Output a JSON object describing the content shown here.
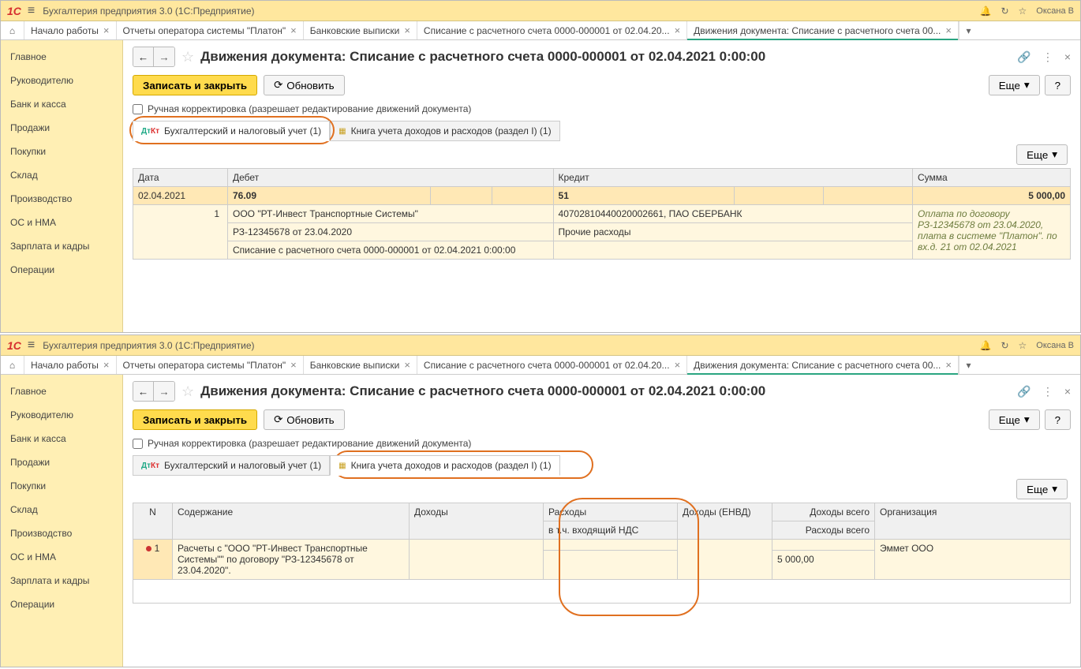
{
  "app_title": "Бухгалтерия предприятия 3.0   (1С:Предприятие)",
  "user": "Оксана В",
  "tabs": [
    {
      "label": "Начало работы"
    },
    {
      "label": "Отчеты оператора системы \"Платон\""
    },
    {
      "label": "Банковские выписки"
    },
    {
      "label": "Списание с расчетного счета 0000-000001 от 02.04.20..."
    },
    {
      "label": "Движения документа: Списание с расчетного счета 00..."
    }
  ],
  "sidebar": [
    "Главное",
    "Руководителю",
    "Банк и касса",
    "Продажи",
    "Покупки",
    "Склад",
    "Производство",
    "ОС и НМА",
    "Зарплата и кадры",
    "Операции"
  ],
  "doc_title": "Движения документа: Списание с расчетного счета 0000-000001 от 02.04.2021 0:00:00",
  "buttons": {
    "save_close": "Записать и закрыть",
    "refresh": "Обновить",
    "more": "Еще",
    "help": "?"
  },
  "checkbox_label": "Ручная корректировка (разрешает редактирование движений документа)",
  "inner_tabs": {
    "accounting": "Бухгалтерский и налоговый учет (1)",
    "kudir": "Книга учета доходов и расходов (раздел I) (1)"
  },
  "acct_headers": {
    "date": "Дата",
    "debit": "Дебет",
    "credit": "Кредит",
    "sum": "Сумма"
  },
  "acct_row1": {
    "date": "02.04.2021",
    "debit": "76.09",
    "credit": "51",
    "sum": "5 000,00"
  },
  "acct_details": {
    "seq": "1",
    "debit1": "ООО \"РТ-Инвест Транспортные Системы\"",
    "debit2": "РЗ-12345678 от 23.04.2020",
    "debit3": "Списание с расчетного счета 0000-000001 от 02.04.2021 0:00:00",
    "credit1": "40702810440020002661, ПАО СБЕРБАНК",
    "credit2": "Прочие расходы",
    "note": "Оплата по договору РЗ-12345678 от 23.04.2020, плата в системе \"Платон\". по вх.д. 21 от 02.04.2021"
  },
  "kudir_headers": {
    "n": "N",
    "content": "Содержание",
    "income": "Доходы",
    "expense": "Расходы",
    "expense_sub": "в т.ч. входящий НДС",
    "envd": "Доходы (ЕНВД)",
    "income_total": "Доходы всего",
    "expense_total": "Расходы всего",
    "org": "Организация"
  },
  "kudir_row": {
    "n": "1",
    "content": "Расчеты с \"ООО \"РТ-Инвест Транспортные Системы\"\" по договору \"РЗ-12345678 от 23.04.2020\".",
    "expense_total": "5 000,00",
    "org": "Эммет ООО"
  }
}
